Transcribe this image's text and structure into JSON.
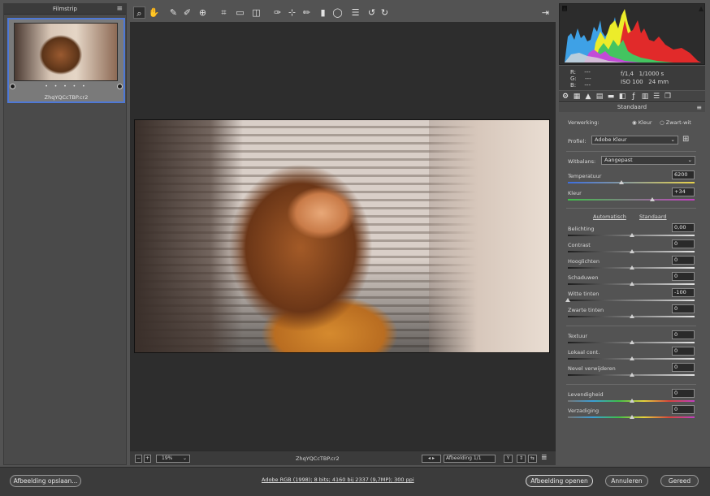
{
  "filmstrip": {
    "title": "Filmstrip",
    "menu_icon": "menu-icon",
    "thumb_filename": "ZhqYQCcTBP.cr2",
    "rating_dots": "• • • • •"
  },
  "toolbar": {
    "tools": [
      "zoom-icon",
      "hand-icon",
      "white-balance-icon",
      "color-sampler-icon",
      "targeted-adjust-icon",
      "crop-icon",
      "straighten-icon",
      "transform-icon",
      "spot-removal-icon",
      "red-eye-icon",
      "brush-icon",
      "graduated-filter-icon",
      "radial-filter-icon",
      "presets-icon",
      "rotate-left-icon",
      "rotate-right-icon"
    ],
    "export_icon": "open-icon"
  },
  "status": {
    "zoom": "19%",
    "filename": "ZhqYQCcTBP.cr2",
    "image_count": "Afbeelding 1/1",
    "y_label": "Y"
  },
  "histogram": {
    "r_label": "R:",
    "g_label": "G:",
    "b_label": "B:",
    "r_val": "---",
    "g_val": "---",
    "b_val": "---",
    "aperture": "f/1,4",
    "shutter": "1/1000 s",
    "iso": "ISO 100",
    "focal": "24 mm"
  },
  "panel": {
    "profile_name": "Standaard",
    "processing_label": "Verwerking:",
    "color_option": "Kleur",
    "bw_option": "Zwart-wit",
    "profile_label": "Profiel:",
    "profile_value": "Adobe Kleur",
    "wb_label": "Witbalans:",
    "wb_value": "Aangepast",
    "temp_label": "Temperatuur",
    "temp_value": "6200",
    "tint_label": "Kleur",
    "tint_value": "+34",
    "auto_link": "Automatisch",
    "default_link": "Standaard",
    "sliders": [
      {
        "label": "Belichting",
        "value": "0,00"
      },
      {
        "label": "Contrast",
        "value": "0"
      },
      {
        "label": "Hooglichten",
        "value": "0"
      },
      {
        "label": "Schaduwen",
        "value": "0"
      },
      {
        "label": "Witte tinten",
        "value": "-100"
      },
      {
        "label": "Zwarte tinten",
        "value": "0"
      },
      {
        "label": "Textuur",
        "value": "0"
      },
      {
        "label": "Lokaal cont.",
        "value": "0"
      },
      {
        "label": "Nevel verwijderen",
        "value": "0"
      },
      {
        "label": "Levendigheid",
        "value": "0"
      },
      {
        "label": "Verzadiging",
        "value": "0"
      }
    ]
  },
  "bottom": {
    "save_label": "Afbeelding opslaan...",
    "info": "Adobe RGB (1998); 8 bits; 4160 bij 2337 (9,7MP); 300 ppi",
    "open_label": "Afbeelding openen",
    "cancel_label": "Annuleren",
    "done_label": "Gereed"
  }
}
